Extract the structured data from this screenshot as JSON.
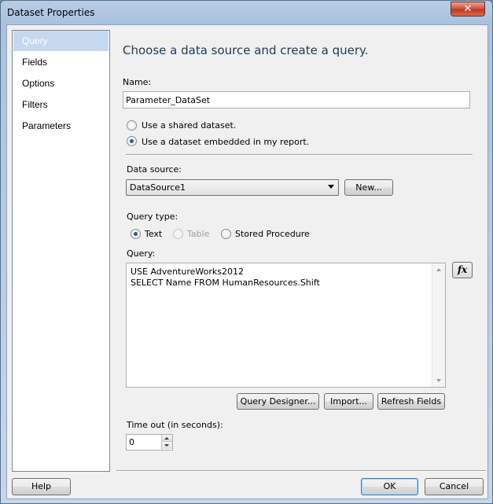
{
  "window": {
    "title": "Dataset Properties",
    "close_glyph": "✕"
  },
  "nav": {
    "items": [
      {
        "label": "Query",
        "selected": true
      },
      {
        "label": "Fields"
      },
      {
        "label": "Options"
      },
      {
        "label": "Filters"
      },
      {
        "label": "Parameters"
      }
    ]
  },
  "main": {
    "heading": "Choose a data source and create a query.",
    "name_label": "Name:",
    "name_value": "Parameter_DataSet",
    "radio_shared": "Use a shared dataset.",
    "radio_embedded": "Use a dataset embedded in my report.",
    "data_source_label": "Data source:",
    "data_source_value": "DataSource1",
    "new_button": "New...",
    "query_type_label": "Query type:",
    "query_type_text": "Text",
    "query_type_table": "Table",
    "query_type_stored": "Stored Procedure",
    "query_label": "Query:",
    "query_lines": [
      "USE AdventureWorks2012",
      "SELECT Name FROM HumanResources.Shift"
    ],
    "fx_label": "fx",
    "query_designer_button": "Query Designer...",
    "import_button": "Import...",
    "refresh_fields_button": "Refresh Fields",
    "timeout_label": "Time out (in seconds):",
    "timeout_value": "0"
  },
  "footer": {
    "help": "Help",
    "ok": "OK",
    "cancel": "Cancel"
  }
}
